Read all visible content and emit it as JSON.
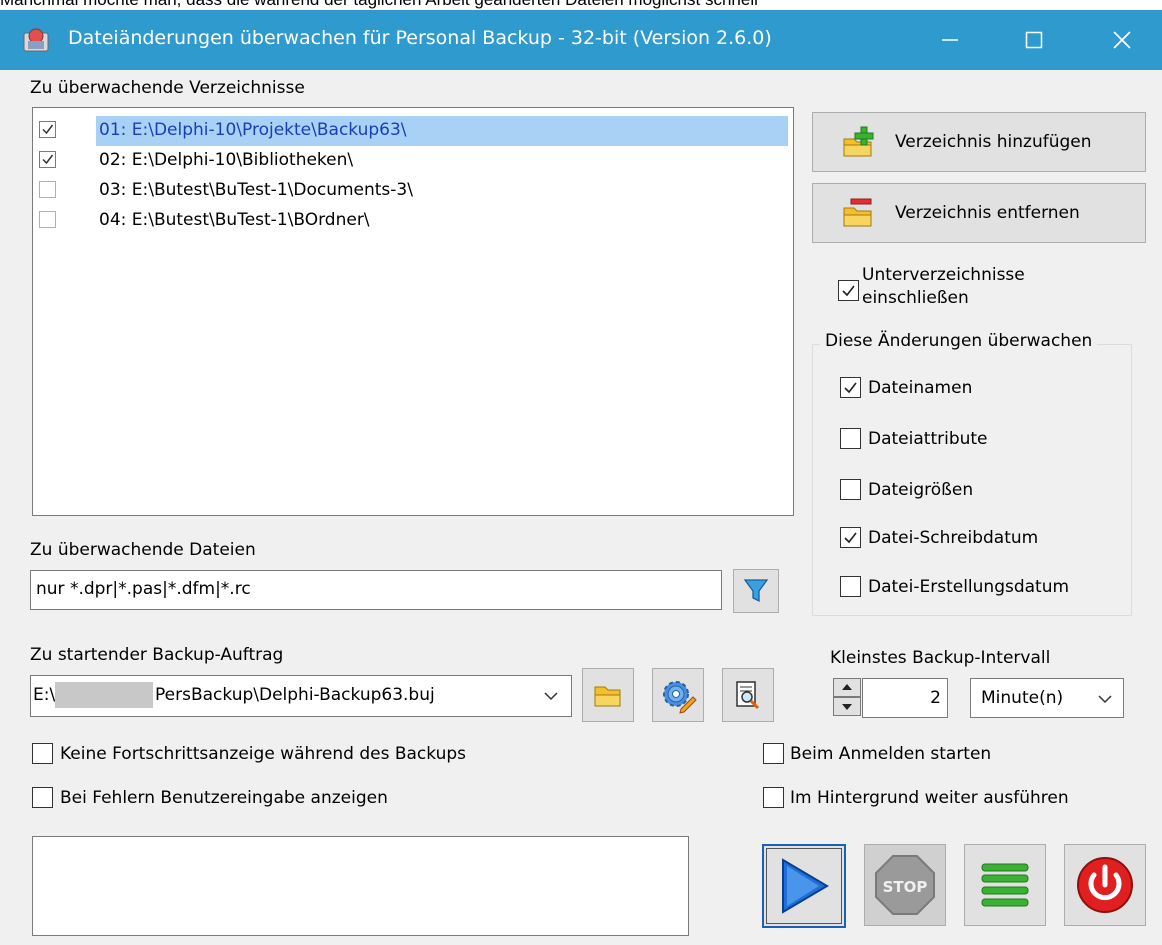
{
  "background_text": "Manchmal möchte man, dass die während der täglichen Arbeit geänderten Dateien möglichst schnell",
  "window": {
    "title": "Dateiänderungen überwachen für Personal Backup - 32-bit (Version 2.6.0)"
  },
  "dirs": {
    "heading": "Zu überwachende Verzeichnisse",
    "items": [
      {
        "label": "01: E:\\Delphi-10\\Projekte\\Backup63\\",
        "checked": true,
        "selected": true
      },
      {
        "label": "02: E:\\Delphi-10\\Bibliotheken\\",
        "checked": true,
        "selected": false
      },
      {
        "label": "03: E:\\Butest\\BuTest-1\\Documents-3\\",
        "checked": false,
        "selected": false
      },
      {
        "label": "04: E:\\Butest\\BuTest-1\\BOrdner\\",
        "checked": false,
        "selected": false
      }
    ],
    "add_label": "Verzeichnis hinzufügen",
    "remove_label": "Verzeichnis entfernen",
    "subdirs_label_1": "Unterverzeichnisse",
    "subdirs_label_2": "einschließen",
    "subdirs_checked": true
  },
  "changes": {
    "legend": "Diese Änderungen überwachen",
    "options": [
      {
        "label": "Dateinamen",
        "checked": true
      },
      {
        "label": "Dateiattribute",
        "checked": false
      },
      {
        "label": "Dateigrößen",
        "checked": false
      },
      {
        "label": "Datei-Schreibdatum",
        "checked": true
      },
      {
        "label": "Datei-Erstellungsdatum",
        "checked": false
      }
    ]
  },
  "files": {
    "heading": "Zu überwachende Dateien",
    "value": "nur *.dpr|*.pas|*.dfm|*.rc"
  },
  "job": {
    "heading": "Zu startender Backup-Auftrag",
    "value_prefix": "E:\\",
    "value_suffix": "PersBackup\\Delphi-Backup63.buj"
  },
  "interval": {
    "heading": "Kleinstes Backup-Intervall",
    "value": "2",
    "unit": "Minute(n)"
  },
  "options": {
    "no_progress": "Keine Fortschrittsanzeige während des Backups",
    "show_errors": "Bei Fehlern Benutzereingabe anzeigen",
    "start_login": "Beim Anmelden starten",
    "background": "Im Hintergrund weiter ausführen"
  },
  "colors": {
    "titlebar": "#2e9acd",
    "selection": "#a8d1f5",
    "play": "#1e6fd9",
    "power": "#e02020",
    "list_green": "#3cb035"
  }
}
